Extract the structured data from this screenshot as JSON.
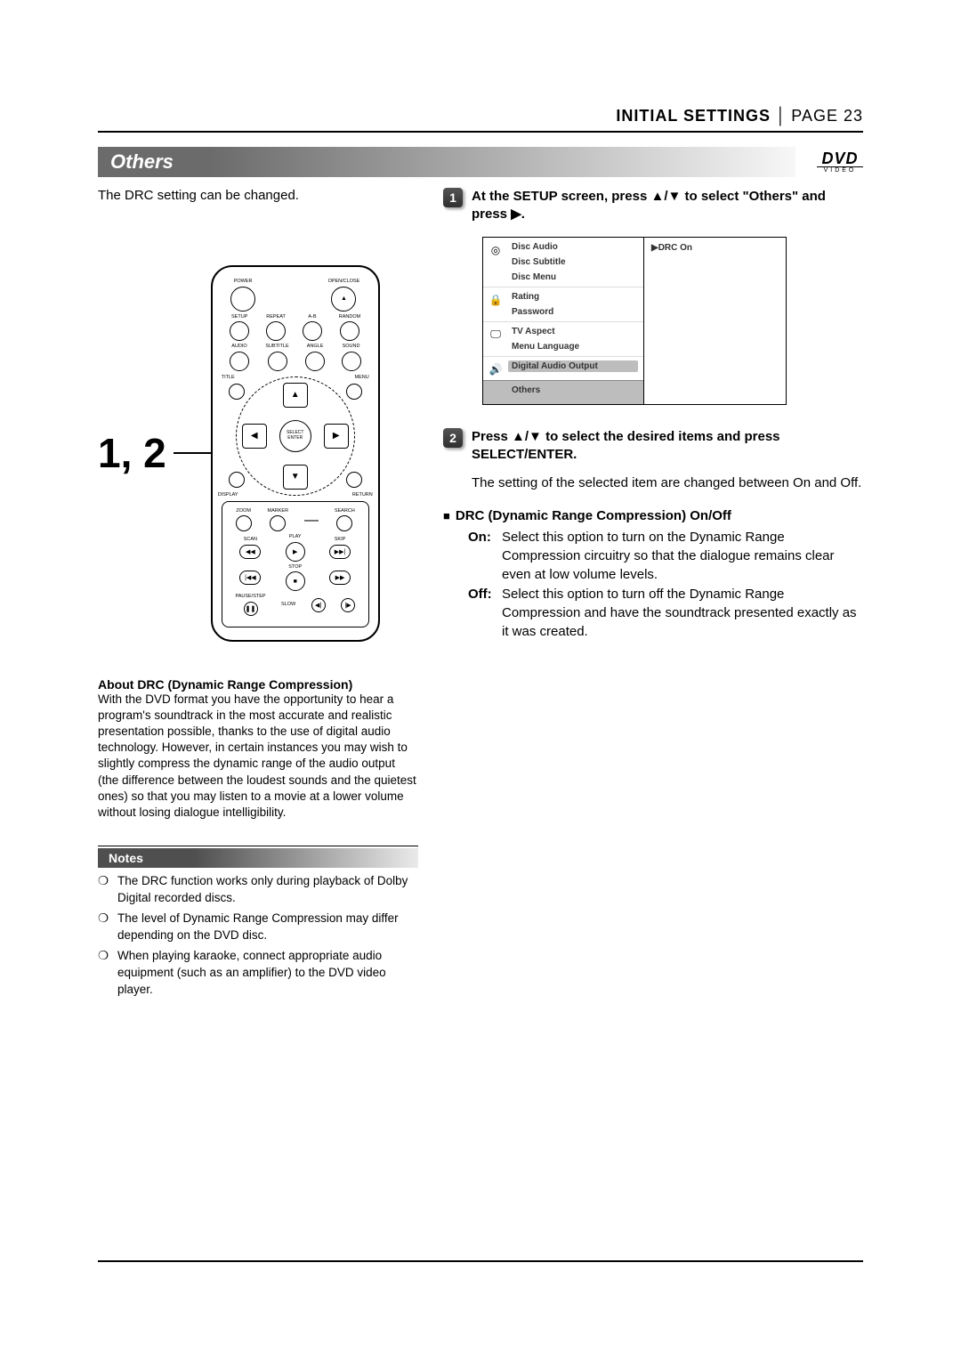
{
  "header": {
    "section": "INITIAL SETTINGS",
    "page_label": "PAGE 23"
  },
  "title": "Others",
  "dvd_logo": {
    "top": "DVD",
    "bottom": "VIDEO"
  },
  "intro": "The DRC setting can be changed.",
  "remote": {
    "callout_label": "1, 2",
    "labels": {
      "power": "POWER",
      "openclose": "OPEN/CLOSE",
      "setup": "SETUP",
      "repeat": "REPEAT",
      "ab": "A-B",
      "random": "RANDOM",
      "audio": "AUDIO",
      "subtitle": "SUBTITLE",
      "angle": "ANGLE",
      "sound": "SOUND",
      "title": "TITLE",
      "menu": "MENU",
      "select_enter": "SELECT\nENTER",
      "display": "DISPLAY",
      "return": "RETURN",
      "zoom": "ZOOM",
      "marker": "MARKER",
      "search": "SEARCH",
      "scan": "SCAN",
      "play": "PLAY",
      "skip": "SKIP",
      "stop": "STOP",
      "pausestep": "PAUSE/STEP",
      "slow": "SLOW"
    }
  },
  "about": {
    "heading": "About DRC (Dynamic Range Compression)",
    "body": "With the DVD format you have the opportunity to hear a program's soundtrack in the most accurate and realistic presentation possible, thanks to the use of digital audio technology. However, in certain instances you may wish to slightly compress the dynamic range of the audio output (the difference between the loudest sounds and the quietest ones) so that you may listen to a movie at a lower volume without losing dialogue intelligibility."
  },
  "notes": {
    "heading": "Notes",
    "items": [
      "The DRC function works only during playback of Dolby Digital recorded discs.",
      "The level of Dynamic Range Compression may differ depending on the DVD disc.",
      "When playing karaoke, connect appropriate audio equipment (such as an amplifier) to the DVD video player."
    ]
  },
  "steps": {
    "s1": {
      "num": "1",
      "text_1": "At the SETUP screen, press ",
      "arrows": "▲/▼",
      "text_2": " to select \"Others\" and press ",
      "right": "▶",
      "text_3": "."
    },
    "s2": {
      "num": "2",
      "text_1": "Press ",
      "arrows": "▲/▼",
      "text_2": " to select the desired items and press SELECT/ENTER.",
      "sub": "The setting of the selected item are changed between On and Off."
    }
  },
  "osd": {
    "groups": [
      {
        "icon": "◎",
        "lines": [
          "Disc Audio",
          "Disc Subtitle",
          "Disc Menu"
        ]
      },
      {
        "icon": "🔒",
        "lines": [
          "Rating",
          "Password"
        ]
      },
      {
        "icon": "🖵",
        "lines": [
          "TV Aspect",
          "Menu Language"
        ]
      },
      {
        "icon": "🔊",
        "lines": [
          "Digital Audio Output"
        ]
      },
      {
        "icon": "",
        "lines": [
          "Others"
        ],
        "selected": true
      }
    ],
    "right_value": "▶DRC On"
  },
  "drc": {
    "heading": "DRC (Dynamic Range Compression) On/Off",
    "on_label": "On:",
    "on_text": "Select this option to turn on the Dynamic Range Compression circuitry so that the dialogue remains clear even at low volume levels.",
    "off_label": "Off:",
    "off_text": "Select this option to turn off the Dynamic Range Compression and have the soundtrack presented exactly as it was created."
  }
}
